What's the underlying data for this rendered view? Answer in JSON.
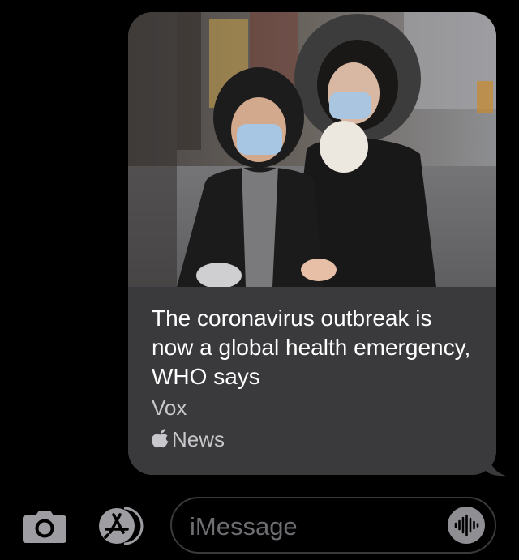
{
  "message": {
    "headline": "The coronavirus outbreak is now a global health emergency, WHO says",
    "source": "Vox",
    "app_name": "News",
    "app_icon": "apple-icon"
  },
  "input_bar": {
    "camera_icon": "camera-icon",
    "apps_icon": "app-store-icon",
    "placeholder": "iMessage",
    "audio_icon": "audio-waveform-icon"
  },
  "colors": {
    "background": "#000000",
    "bubble": "#3a3a3c",
    "headline_text": "#ffffff",
    "secondary_text": "#c7c7cc",
    "placeholder_text": "#6d6d72",
    "icon_gray": "#9d9da2"
  }
}
